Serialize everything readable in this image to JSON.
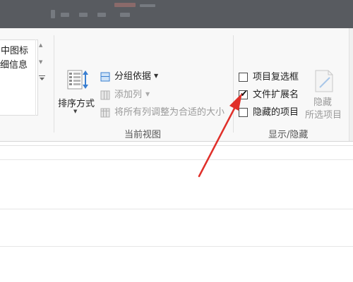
{
  "title_bar": {
    "partial_text": "",
    "tab_labels": [
      "",
      "",
      ""
    ]
  },
  "layout_list": {
    "items": [
      "中图标",
      "详细信息"
    ],
    "scroll_icons": [
      "scroll-up-icon",
      "scroll-down-icon",
      "expand-icon"
    ]
  },
  "current_view": {
    "sort_label": "排序方式",
    "group_by_label": "分组依据",
    "add_column_label": "添加列",
    "fit_columns_label": "将所有列调整为合适的大小",
    "group_title": "当前视图",
    "icons": [
      "sort-icon",
      "group-by-icon",
      "add-column-icon",
      "fit-columns-icon"
    ]
  },
  "show_hide": {
    "options": [
      {
        "label": "项目复选框",
        "checked": false
      },
      {
        "label": "文件扩展名",
        "checked": true
      },
      {
        "label": "隐藏的项目",
        "checked": false
      }
    ],
    "check_mark": "✔",
    "hide_selected_line1": "隐藏",
    "hide_selected_line2": "所选项目",
    "group_title": "显示/隐藏"
  },
  "colors": {
    "annotation_arrow": "#e0302a",
    "ribbon_bg": "#f8f8f8",
    "disabled_text": "#9a9a9a"
  }
}
